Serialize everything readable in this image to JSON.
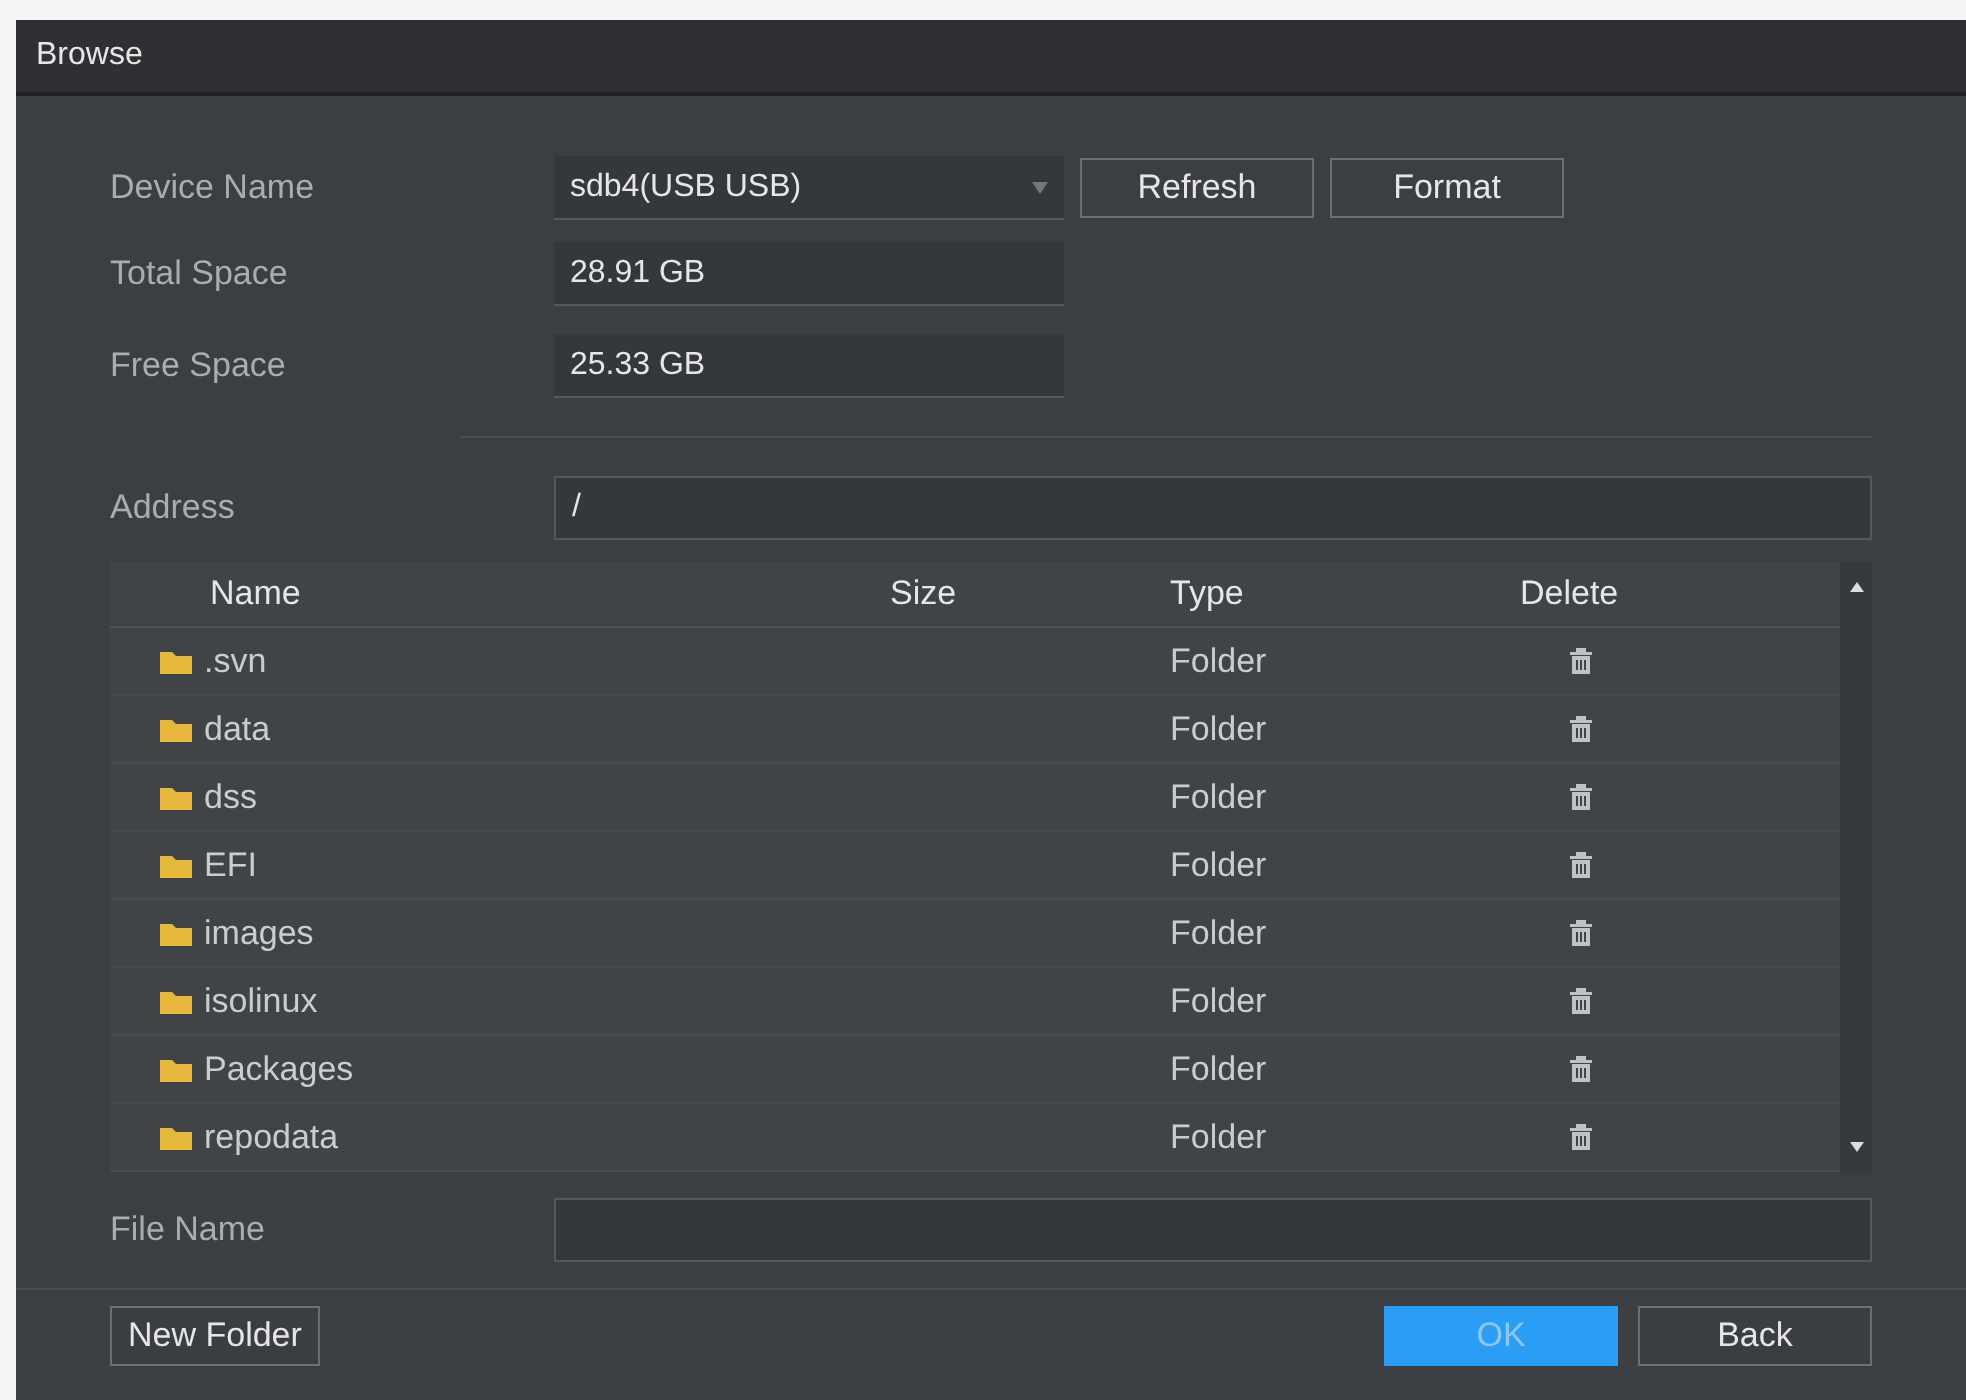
{
  "window": {
    "title": "Browse"
  },
  "device": {
    "label": "Device Name",
    "value": "sdb4(USB USB)"
  },
  "device_buttons": [
    "Refresh",
    "Format"
  ],
  "info": [
    {
      "label": "Total Space",
      "value": "28.91 GB"
    },
    {
      "label": "Free Space",
      "value": "25.33 GB"
    }
  ],
  "address": {
    "label": "Address",
    "value": "/"
  },
  "table": {
    "columns": [
      "Name",
      "Size",
      "Type",
      "Delete"
    ],
    "rows": [
      {
        "name": ".svn",
        "size": "",
        "type": "Folder"
      },
      {
        "name": "data",
        "size": "",
        "type": "Folder"
      },
      {
        "name": "dss",
        "size": "",
        "type": "Folder"
      },
      {
        "name": "EFI",
        "size": "",
        "type": "Folder"
      },
      {
        "name": "images",
        "size": "",
        "type": "Folder"
      },
      {
        "name": "isolinux",
        "size": "",
        "type": "Folder"
      },
      {
        "name": "Packages",
        "size": "",
        "type": "Folder"
      },
      {
        "name": "repodata",
        "size": "",
        "type": "Folder"
      }
    ]
  },
  "file_name": {
    "label": "File Name"
  },
  "buttons": [
    {
      "label": "New Folder",
      "kind": "secondary",
      "disabled": false
    },
    {
      "label": "OK",
      "kind": "primary",
      "disabled": true
    },
    {
      "label": "Back",
      "kind": "secondary",
      "disabled": false
    }
  ]
}
